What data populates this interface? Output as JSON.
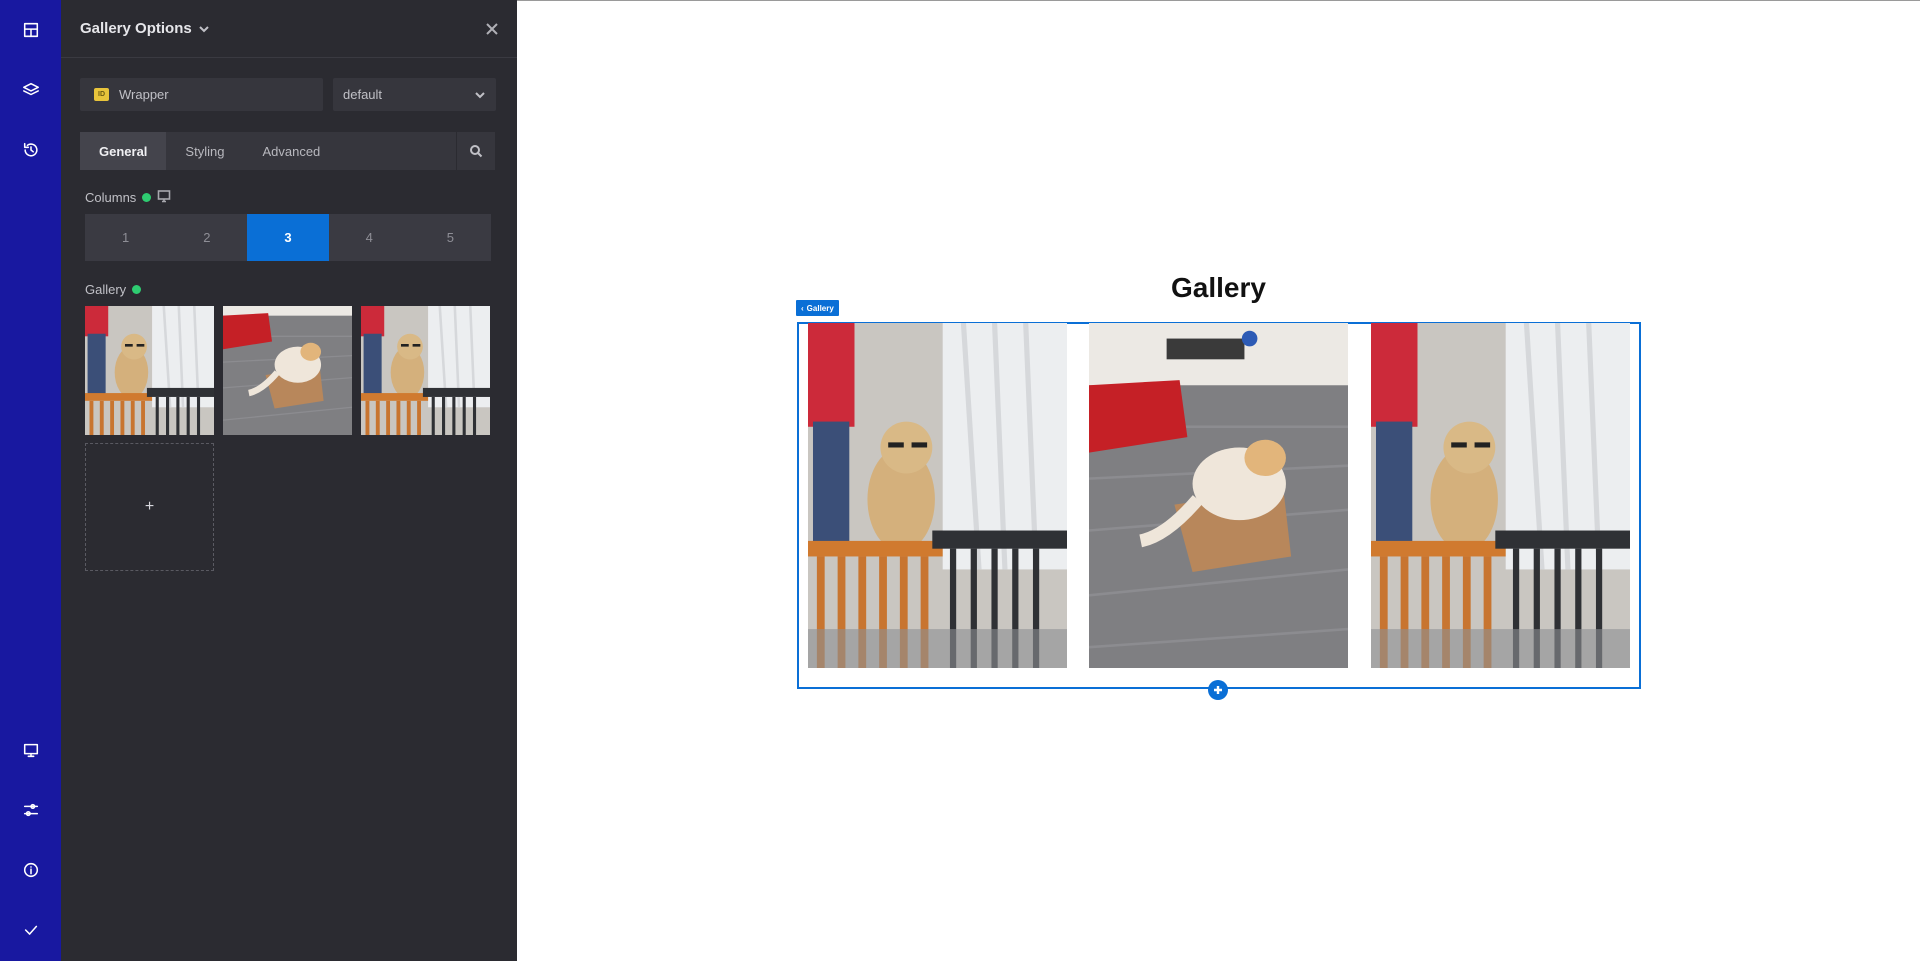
{
  "panel": {
    "title": "Gallery Options",
    "selector": {
      "badge": "ID",
      "name": "Wrapper"
    },
    "state": "default",
    "tabs": [
      "General",
      "Styling",
      "Advanced"
    ],
    "active_tab": "General",
    "columns": {
      "label": "Columns",
      "options": [
        "1",
        "2",
        "3",
        "4",
        "5"
      ],
      "selected": "3"
    },
    "gallery": {
      "label": "Gallery",
      "images": [
        "dog-at-gate",
        "cat-in-box",
        "dog-at-gate"
      ],
      "add_label": "+"
    }
  },
  "canvas": {
    "heading": "Gallery",
    "tag": "Gallery",
    "images": [
      "dog-at-gate",
      "cat-in-box",
      "dog-at-gate"
    ]
  },
  "icons": {
    "rail_top": [
      "layout-icon",
      "layers-icon",
      "history-icon"
    ],
    "rail_bottom": [
      "desktop-icon",
      "sliders-icon",
      "info-icon",
      "check-icon"
    ]
  },
  "colors": {
    "rail": "#1818a0",
    "panel": "#2b2b31",
    "accent": "#0a6fd6",
    "status_dot": "#2ecc71"
  }
}
